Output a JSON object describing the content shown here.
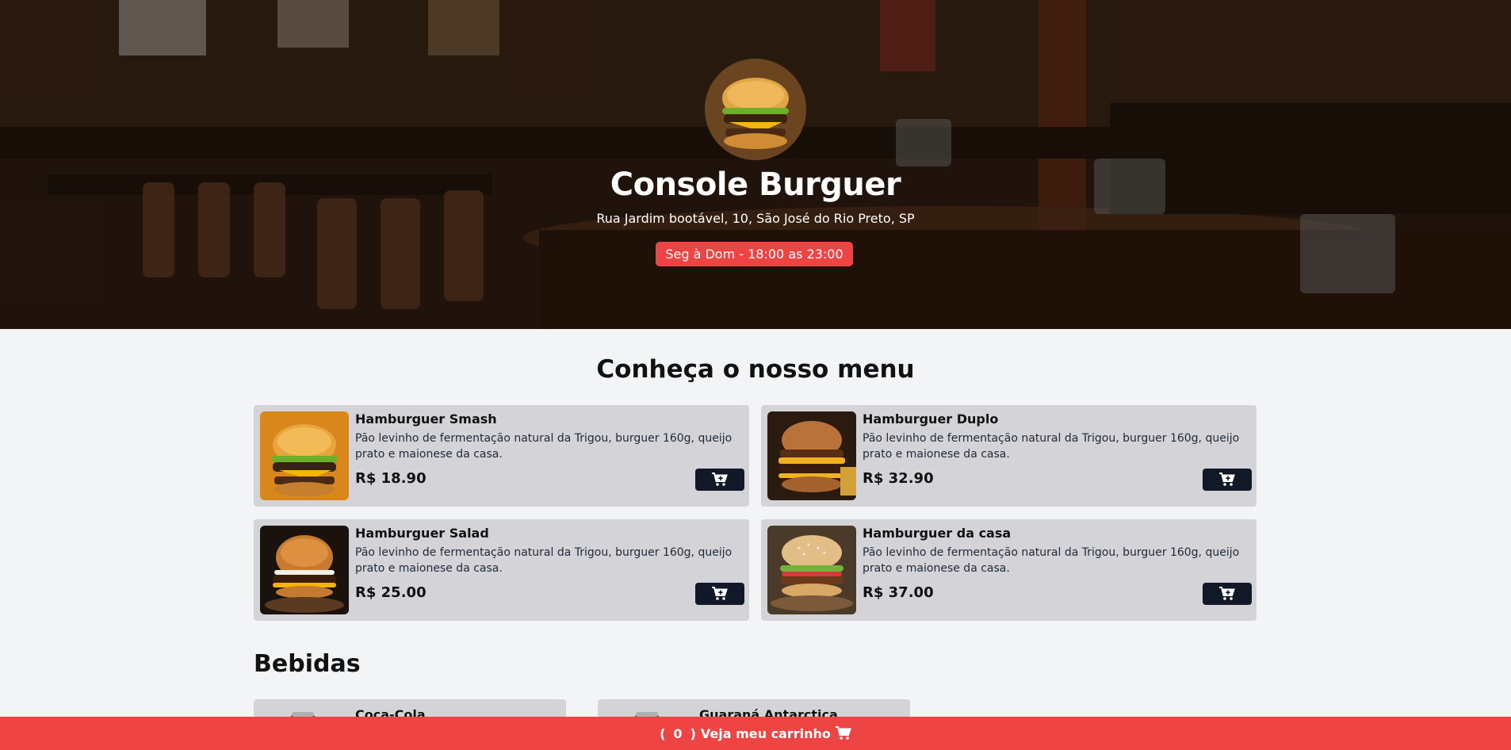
{
  "hero": {
    "restaurant_name": "Console Burguer",
    "address": "Rua Jardim bootável, 10, São José do Rio Preto, SP",
    "hours": "Seg à Dom - 18:00 as 23:00",
    "logo_icon": "burger-logo"
  },
  "menu": {
    "title": "Conheça o nosso menu",
    "items": [
      {
        "name": "Hamburguer Smash",
        "description": "Pão levinho de fermentação natural da Trigou, burguer 160g, queijo prato e maionese da casa.",
        "price": "R$ 18.90"
      },
      {
        "name": "Hamburguer Duplo",
        "description": "Pão levinho de fermentação natural da Trigou, burguer 160g, queijo prato e maionese da casa.",
        "price": "R$ 32.90"
      },
      {
        "name": "Hamburguer Salad",
        "description": "Pão levinho de fermentação natural da Trigou, burguer 160g, queijo prato e maionese da casa.",
        "price": "R$ 25.00"
      },
      {
        "name": "Hamburguer da casa",
        "description": "Pão levinho de fermentação natural da Trigou, burguer 160g, queijo prato e maionese da casa.",
        "price": "R$ 37.00"
      }
    ]
  },
  "drinks": {
    "title": "Bebidas",
    "items": [
      {
        "name": "Coca-Cola"
      },
      {
        "name": "Guaraná Antarctica"
      }
    ]
  },
  "cart": {
    "open_paren": "(",
    "count": "0",
    "close_paren": ")",
    "label": "Veja meu carrinho",
    "icon": "cart-icon"
  },
  "colors": {
    "accent": "#ef4444",
    "button_dark": "#111827",
    "card_bg": "#d4d4d8",
    "page_bg": "#f3f4f6"
  }
}
